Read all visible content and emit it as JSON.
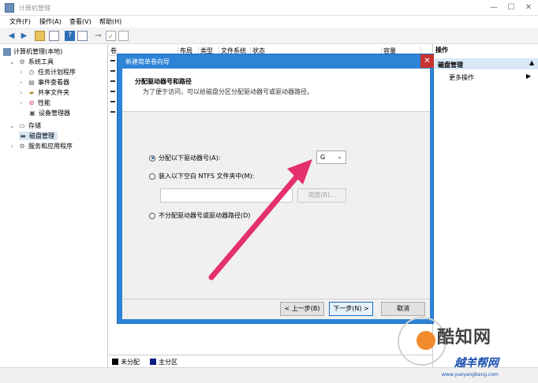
{
  "window": {
    "title": "计算机管理",
    "min": "—",
    "max": "☐",
    "close": "✕"
  },
  "menu": [
    "文件(F)",
    "操作(A)",
    "查看(V)",
    "帮助(H)"
  ],
  "toolbar_icons": [
    "back-arrow-icon",
    "forward-arrow-icon",
    "folder-icon",
    "list-icon",
    "help-icon",
    "details-icon",
    "disk-icon",
    "check-icon",
    "dialog-icon"
  ],
  "tree": [
    {
      "label": "计算机管理(本地)",
      "indent": 0
    },
    {
      "label": "系统工具",
      "indent": 1
    },
    {
      "label": "任务计划程序",
      "indent": 2
    },
    {
      "label": "事件查看器",
      "indent": 2
    },
    {
      "label": "共享文件夹",
      "indent": 2
    },
    {
      "label": "性能",
      "indent": 2
    },
    {
      "label": "设备管理器",
      "indent": 2
    },
    {
      "label": "存储",
      "indent": 1
    },
    {
      "label": "磁盘管理",
      "indent": 2,
      "selected": true
    },
    {
      "label": "服务和应用程序",
      "indent": 1
    }
  ],
  "columns": [
    "卷",
    "布局",
    "类型",
    "文件系统",
    "状态",
    "容量"
  ],
  "legend": {
    "unallocated": "未分配",
    "primary": "主分区"
  },
  "actions": {
    "header": "操作",
    "section": "磁盘管理",
    "more": "更多操作"
  },
  "wizard": {
    "title": "新建简单卷向导",
    "close": "✕",
    "heading": "分配驱动器号和路径",
    "subheading": "为了便于访问，可以给磁盘分区分配驱动器号或驱动器路径。",
    "option1": "分配以下驱动器号(A):",
    "drive_letter": "G",
    "option2": "装入以下空白 NTFS 文件夹中(M):",
    "browse": "浏览(R)...",
    "option3": "不分配驱动器号或驱动器路径(D)",
    "back": "< 上一步(B)",
    "next": "下一步(N) >",
    "cancel": "取消"
  },
  "watermark": {
    "brand": "酷知网",
    "brand2": "越羊帮网",
    "url": "www.yueyangbang.com"
  },
  "colors": {
    "accent": "#2d83d6",
    "arrow": "#e5306e",
    "selected": "#d9e8f7"
  }
}
